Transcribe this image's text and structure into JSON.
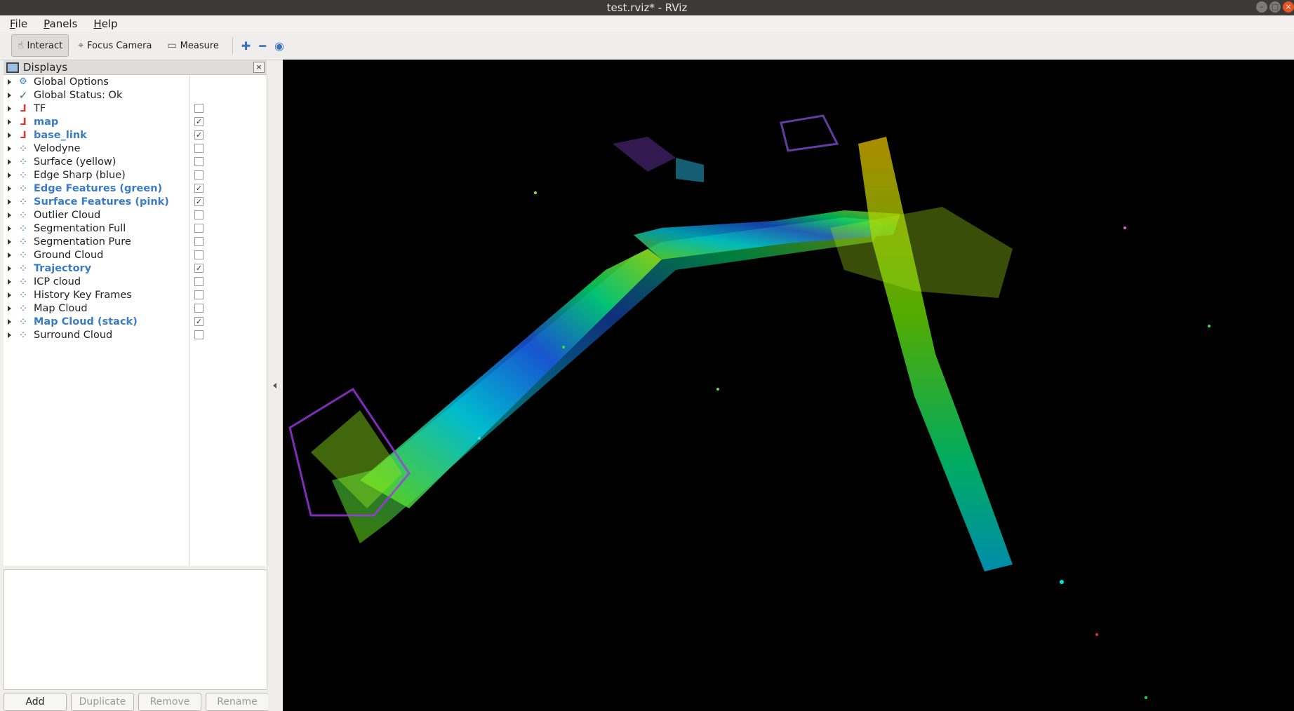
{
  "window": {
    "title": "test.rviz* - RViz"
  },
  "menu": [
    {
      "key": "F",
      "rest": "ile"
    },
    {
      "key": "P",
      "rest": "anels"
    },
    {
      "key": "H",
      "rest": "elp"
    }
  ],
  "toolbar": {
    "interact": "Interact",
    "focus_camera": "Focus Camera",
    "measure": "Measure"
  },
  "displays_panel": {
    "title": "Displays",
    "items": [
      {
        "label": "Global Options",
        "icon": "gear-icon",
        "checkbox": null,
        "active": false
      },
      {
        "label": "Global Status: Ok",
        "icon": "ok-icon",
        "checkbox": null,
        "active": false
      },
      {
        "label": "TF",
        "icon": "axes-icon",
        "checkbox": false,
        "active": false
      },
      {
        "label": "map",
        "icon": "axes-icon",
        "checkbox": true,
        "active": true
      },
      {
        "label": "base_link",
        "icon": "axes-icon",
        "checkbox": true,
        "active": true
      },
      {
        "label": "Velodyne",
        "icon": "pointcloud-icon",
        "checkbox": false,
        "active": false
      },
      {
        "label": "Surface (yellow)",
        "icon": "pointcloud-icon",
        "checkbox": false,
        "active": false
      },
      {
        "label": "Edge Sharp (blue)",
        "icon": "pointcloud-icon",
        "checkbox": false,
        "active": false
      },
      {
        "label": "Edge Features (green)",
        "icon": "pointcloud-icon",
        "checkbox": true,
        "active": true
      },
      {
        "label": "Surface Features (pink)",
        "icon": "pointcloud-icon",
        "checkbox": true,
        "active": true
      },
      {
        "label": "Outlier Cloud",
        "icon": "pointcloud-icon",
        "checkbox": false,
        "active": false
      },
      {
        "label": "Segmentation Full",
        "icon": "pointcloud-icon",
        "checkbox": false,
        "active": false
      },
      {
        "label": "Segmentation Pure",
        "icon": "pointcloud-icon",
        "checkbox": false,
        "active": false
      },
      {
        "label": "Ground Cloud",
        "icon": "pointcloud-icon",
        "checkbox": false,
        "active": false
      },
      {
        "label": "Trajectory",
        "icon": "pointcloud-icon",
        "checkbox": true,
        "active": true
      },
      {
        "label": "ICP cloud",
        "icon": "pointcloud-icon",
        "checkbox": false,
        "active": false
      },
      {
        "label": "History Key Frames",
        "icon": "pointcloud-icon",
        "checkbox": false,
        "active": false
      },
      {
        "label": "Map Cloud",
        "icon": "pointcloud-icon",
        "checkbox": false,
        "active": false
      },
      {
        "label": "Map Cloud (stack)",
        "icon": "pointcloud-icon",
        "checkbox": true,
        "active": true
      },
      {
        "label": "Surround Cloud",
        "icon": "pointcloud-icon",
        "checkbox": false,
        "active": false
      }
    ],
    "buttons": {
      "add": "Add",
      "duplicate": "Duplicate",
      "remove": "Remove",
      "rename": "Rename"
    }
  }
}
